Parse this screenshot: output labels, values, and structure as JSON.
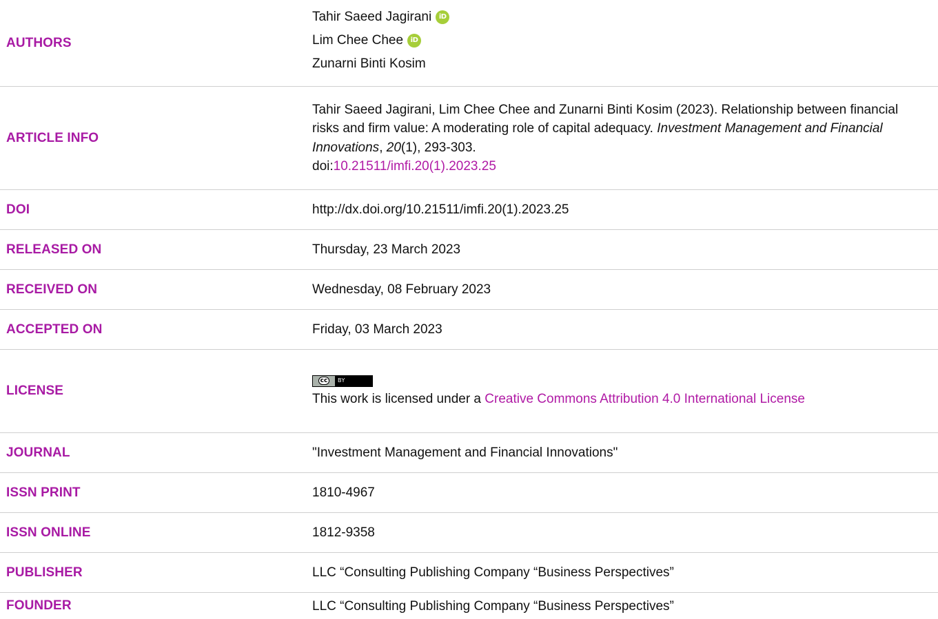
{
  "rows": {
    "authors": {
      "label": "AUTHORS",
      "names": [
        "Tahir Saeed Jagirani",
        "Lim Chee Chee",
        "Zunarni Binti Kosim"
      ],
      "orcid_icon_text": "iD"
    },
    "article_info": {
      "label": "ARTICLE INFO",
      "citation_plain": "Tahir Saeed Jagirani, Lim Chee Chee and Zunarni Binti Kosim (2023). Relationship between financial risks and firm value: A moderating role of capital adequacy. ",
      "journal_italic": "Investment Management and Financial Innovations",
      "sep1": ", ",
      "volume_italic": "20",
      "issue_pages": "(1), 293-303.",
      "doi_prefix": "doi:",
      "doi_link": "10.21511/imfi.20(1).2023.25"
    },
    "doi": {
      "label": "DOI",
      "value": "http://dx.doi.org/10.21511/imfi.20(1).2023.25"
    },
    "released_on": {
      "label": "RELEASED ON",
      "value": "Thursday, 23 March 2023"
    },
    "received_on": {
      "label": "RECEIVED ON",
      "value": "Wednesday, 08 February 2023"
    },
    "accepted_on": {
      "label": "ACCEPTED ON",
      "value": "Friday, 03 March 2023"
    },
    "license": {
      "label": "LICENSE",
      "badge_left": "cc",
      "badge_right": "BY",
      "text_prefix": "This work is licensed under a ",
      "link_text": "Creative Commons Attribution 4.0 International License"
    },
    "journal": {
      "label": "JOURNAL",
      "value": "\"Investment Management and Financial Innovations\""
    },
    "issn_print": {
      "label": "ISSN PRINT",
      "value": "1810-4967"
    },
    "issn_online": {
      "label": "ISSN ONLINE",
      "value": "1812-9358"
    },
    "publisher": {
      "label": "PUBLISHER",
      "value": "LLC “Consulting Publishing Company “Business Perspectives”"
    },
    "founder": {
      "label": "FOUNDER",
      "value": "LLC “Consulting Publishing Company “Business Perspectives”"
    }
  },
  "colors": {
    "label": "#a81aa4",
    "link": "#b01aa5",
    "orcid": "#a6ce39",
    "divider": "#cfcfcf"
  }
}
